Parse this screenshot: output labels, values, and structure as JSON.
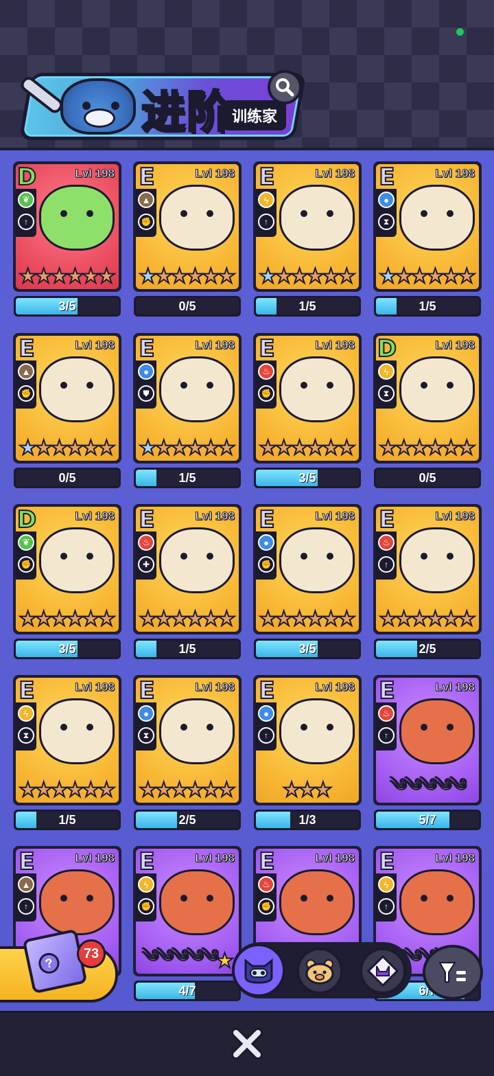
{
  "header": {
    "title": "进阶",
    "subtitle": "训练家",
    "search_icon": "search-icon"
  },
  "cards": [
    {
      "rank": "D",
      "level": "Lvl 198",
      "bg": "red",
      "element": "leaf",
      "elem_color": "#55c34a",
      "role": "up-arrow",
      "progress": "3/5",
      "fill": 0.6,
      "stars": "6-orange"
    },
    {
      "rank": "E",
      "level": "Lvl 198",
      "bg": "yellow",
      "element": "earth",
      "elem_color": "#8a6a4a",
      "role": "fist",
      "progress": "0/5",
      "fill": 0,
      "stars": "1-blue-5-orange"
    },
    {
      "rank": "E",
      "level": "Lvl 198",
      "bg": "yellow",
      "element": "lightning",
      "elem_color": "#f5b62a",
      "role": "up-arrow",
      "progress": "1/5",
      "fill": 0.2,
      "stars": "1-blue-5-orange"
    },
    {
      "rank": "E",
      "level": "Lvl 198",
      "bg": "yellow",
      "element": "water",
      "elem_color": "#3d8ce8",
      "role": "hourglass",
      "progress": "1/5",
      "fill": 0.2,
      "stars": "1-blue-5-orange"
    },
    {
      "rank": "E",
      "level": "Lvl 198",
      "bg": "yellow",
      "element": "earth",
      "elem_color": "#8a6a4a",
      "role": "fist",
      "progress": "0/5",
      "fill": 0,
      "stars": "1-blue-5-orange"
    },
    {
      "rank": "E",
      "level": "Lvl 198",
      "bg": "yellow",
      "element": "water",
      "elem_color": "#3d8ce8",
      "role": "shield",
      "progress": "1/5",
      "fill": 0.2,
      "stars": "1-blue-5-orange"
    },
    {
      "rank": "E",
      "level": "Lvl 198",
      "bg": "yellow",
      "element": "fire",
      "elem_color": "#e8443b",
      "role": "fist",
      "progress": "3/5",
      "fill": 0.6,
      "stars": "6-orange"
    },
    {
      "rank": "D",
      "level": "Lvl 198",
      "bg": "yellow",
      "element": "lightning",
      "elem_color": "#f5b62a",
      "role": "hourglass",
      "progress": "0/5",
      "fill": 0,
      "stars": "6-orange"
    },
    {
      "rank": "D",
      "level": "Lvl 198",
      "bg": "yellow",
      "element": "leaf",
      "elem_color": "#55c34a",
      "role": "fist",
      "progress": "3/5",
      "fill": 0.6,
      "stars": "6-orange"
    },
    {
      "rank": "E",
      "level": "Lvl 198",
      "bg": "yellow",
      "element": "fire",
      "elem_color": "#e8443b",
      "role": "plus",
      "progress": "1/5",
      "fill": 0.2,
      "stars": "6-orange"
    },
    {
      "rank": "E",
      "level": "Lvl 198",
      "bg": "yellow",
      "element": "water",
      "elem_color": "#3d8ce8",
      "role": "fist",
      "progress": "3/5",
      "fill": 0.6,
      "stars": "6-orange"
    },
    {
      "rank": "E",
      "level": "Lvl 198",
      "bg": "yellow",
      "element": "fire",
      "elem_color": "#e8443b",
      "role": "up-arrow",
      "progress": "2/5",
      "fill": 0.4,
      "stars": "6-orange"
    },
    {
      "rank": "E",
      "level": "Lvl 198",
      "bg": "yellow",
      "element": "lightning",
      "elem_color": "#f5b62a",
      "role": "hourglass",
      "progress": "1/5",
      "fill": 0.2,
      "stars": "6-orange"
    },
    {
      "rank": "E",
      "level": "Lvl 198",
      "bg": "yellow",
      "element": "water",
      "elem_color": "#3d8ce8",
      "role": "hourglass",
      "progress": "2/5",
      "fill": 0.4,
      "stars": "6-orange"
    },
    {
      "rank": "E",
      "level": "Lvl 198",
      "bg": "yellow",
      "element": "water",
      "elem_color": "#3d8ce8",
      "role": "up-arrow",
      "progress": "1/3",
      "fill": 0.3333,
      "stars": "3-orange"
    },
    {
      "rank": "E",
      "level": "Lvl 198",
      "bg": "purple",
      "element": "fire",
      "elem_color": "#e8443b",
      "role": "up-arrow",
      "progress": "5/7",
      "fill": 0.714,
      "stars": "waves"
    },
    {
      "rank": "E",
      "level": "Lvl 198",
      "bg": "purple",
      "element": "earth",
      "elem_color": "#8a6a4a",
      "role": "up-arrow",
      "progress": "",
      "fill": 0,
      "stars": "none"
    },
    {
      "rank": "E",
      "level": "Lvl 198",
      "bg": "purple",
      "element": "lightning",
      "elem_color": "#f5b62a",
      "role": "fist",
      "progress": "4/7",
      "fill": 0.571,
      "stars": "waves-gold"
    },
    {
      "rank": "E",
      "level": "Lvl 198",
      "bg": "purple",
      "element": "fire",
      "elem_color": "#e8443b",
      "role": "fist",
      "progress": "",
      "fill": 0,
      "stars": "none"
    },
    {
      "rank": "E",
      "level": "Lvl 198",
      "bg": "purple",
      "element": "lightning",
      "elem_color": "#f5b62a",
      "role": "up-arrow",
      "progress": "6/7",
      "fill": 0.857,
      "stars": "waves"
    }
  ],
  "chest": {
    "count": "73"
  },
  "tabs": [
    {
      "name": "tab-cat",
      "icon": "cat-face-icon",
      "color": "#7b61ff"
    },
    {
      "name": "tab-bear",
      "icon": "bear-face-icon",
      "color": "#f1c477"
    },
    {
      "name": "tab-gem",
      "icon": "gem-cat-icon",
      "color": "#e8dcff"
    }
  ],
  "bottom": {
    "close_icon": "close-icon",
    "filter_icon": "filter-icon"
  }
}
